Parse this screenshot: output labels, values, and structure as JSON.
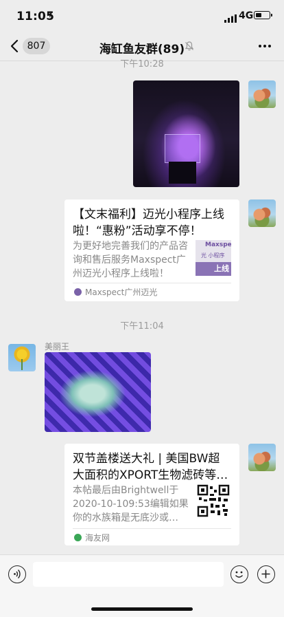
{
  "status_bar": {
    "time": "11:05",
    "network": "4G",
    "location_icon": "location-arrow-icon",
    "signal_icon": "cellular-signal-icon",
    "battery_icon": "battery-icon",
    "battery_level": 0.45
  },
  "nav": {
    "back_icon": "chevron-left-icon",
    "unread_count": "807",
    "title": "海缸鱼友群(89)",
    "mute_icon": "bell-slash-icon",
    "more_icon": "more-dots-icon"
  },
  "chat": {
    "timestamp_top": "下午10:28",
    "timestamp_mid": "下午11:04",
    "link_card_1": {
      "title": "【文末福利】迈光小程序上线啦！“惠粉”活动享不停！",
      "description": "为更好地完善我们的产品咨询和售后服务Maxspect广州迈光小程序上线啦！",
      "thumb_brand": "Maxspect",
      "thumb_sub": "光 小程序",
      "thumb_badge": "上线",
      "source": "Maxspect广州迈光"
    },
    "sender_name": "美丽王",
    "link_card_2": {
      "title": "双节盖楼送大礼 | 美国BW超大面积的XPORT生物滤砖等…",
      "description": "本帖最后由Brightwell于2020-10-109:53编辑如果你的水族箱是无底沙或…",
      "source": "海友网",
      "thumb_icon": "qr-code-icon"
    }
  },
  "input_bar": {
    "voice_icon": "voice-icon",
    "input_value": "",
    "emoji_icon": "emoji-smile-icon",
    "plus_icon": "plus-circle-icon"
  },
  "colors": {
    "background": "#ededed",
    "card": "#ffffff",
    "muted_text": "#888888",
    "source_green": "#3aa757"
  }
}
